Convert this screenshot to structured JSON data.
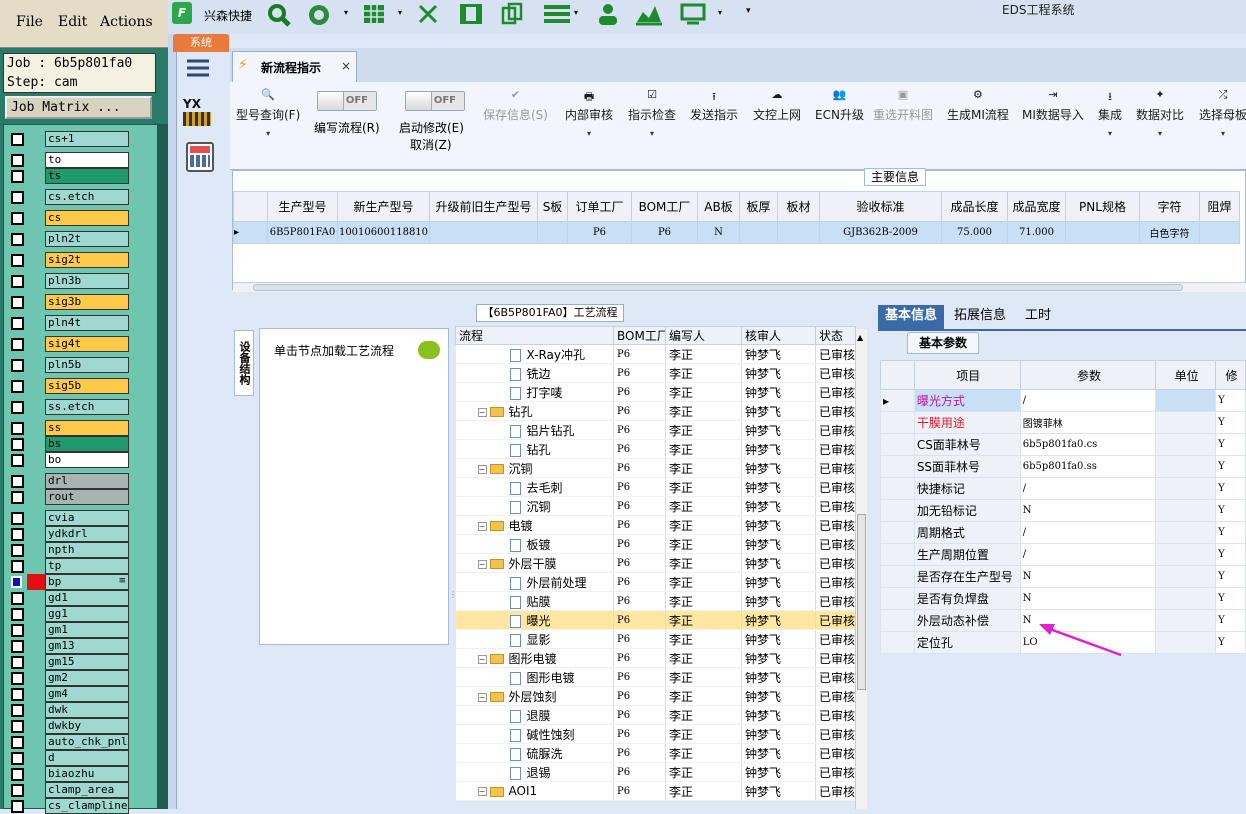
{
  "genesis": {
    "menu": [
      "File",
      "Edit",
      "Actions"
    ],
    "job_label": "Job : 6b5p801fa0",
    "step_label": "Step: cam",
    "job_matrix_button": "Job Matrix ...",
    "layers": [
      {
        "name": "cs+1",
        "color": "#9ed8d0"
      },
      {
        "name": "to",
        "color": "#ffffff"
      },
      {
        "name": "ts",
        "color": "#1f9a6e"
      },
      {
        "name": "cs.etch",
        "color": "#9ed8d0"
      },
      {
        "name": "cs",
        "color": "#ffc94a"
      },
      {
        "name": "pln2t",
        "color": "#9ed8d0"
      },
      {
        "name": "sig2t",
        "color": "#ffc94a"
      },
      {
        "name": "pln3b",
        "color": "#9ed8d0"
      },
      {
        "name": "sig3b",
        "color": "#ffc94a"
      },
      {
        "name": "pln4t",
        "color": "#9ed8d0"
      },
      {
        "name": "sig4t",
        "color": "#ffc94a"
      },
      {
        "name": "pln5b",
        "color": "#9ed8d0"
      },
      {
        "name": "sig5b",
        "color": "#ffc94a"
      },
      {
        "name": "ss.etch",
        "color": "#9ed8d0"
      },
      {
        "name": "ss",
        "color": "#ffc94a"
      },
      {
        "name": "bs",
        "color": "#1f9a6e"
      },
      {
        "name": "bo",
        "color": "#ffffff"
      },
      {
        "name": "drl",
        "color": "#a8b4b2"
      },
      {
        "name": "rout",
        "color": "#a8b4b2"
      },
      {
        "name": "cvia",
        "color": "#9ed8d0"
      },
      {
        "name": "ydkdrl",
        "color": "#9ed8d0"
      },
      {
        "name": "npth",
        "color": "#9ed8d0"
      },
      {
        "name": "tp",
        "color": "#9ed8d0"
      },
      {
        "name": "bp",
        "color": "#9ed8d0",
        "selected": true
      },
      {
        "name": "gd1",
        "color": "#9ed8d0"
      },
      {
        "name": "gg1",
        "color": "#9ed8d0"
      },
      {
        "name": "gm1",
        "color": "#9ed8d0"
      },
      {
        "name": "gm13",
        "color": "#9ed8d0"
      },
      {
        "name": "gm15",
        "color": "#9ed8d0"
      },
      {
        "name": "gm2",
        "color": "#9ed8d0"
      },
      {
        "name": "gm4",
        "color": "#9ed8d0"
      },
      {
        "name": "dwk",
        "color": "#9ed8d0"
      },
      {
        "name": "dwkby",
        "color": "#9ed8d0"
      },
      {
        "name": "auto_chk_pnl",
        "color": "#9ed8d0"
      },
      {
        "name": "d",
        "color": "#9ed8d0"
      },
      {
        "name": "biaozhu",
        "color": "#9ed8d0"
      },
      {
        "name": "clamp_area",
        "color": "#9ed8d0"
      },
      {
        "name": "cs_clampline",
        "color": "#9ed8d0"
      }
    ],
    "selected_marker": "≡"
  },
  "app": {
    "title": "EDS工程系统",
    "toolbar_label": "兴森快捷",
    "system_tab": "系统",
    "doc_tab": "新流程指示",
    "doc_tab_close": "×"
  },
  "ribbon": {
    "buttons": [
      {
        "label": "型号查询(F)",
        "icon": "magnifier",
        "glyph": "🔍",
        "has_arrow": true,
        "disabled": false
      },
      {
        "label": "保存信息(S)",
        "icon": "check",
        "glyph": "✔",
        "has_arrow": false,
        "disabled": true
      },
      {
        "label": "内部审核",
        "icon": "printer",
        "glyph": "🖶",
        "has_arrow": true,
        "disabled": false
      },
      {
        "label": "指示检查",
        "icon": "checkbox",
        "glyph": "☑",
        "has_arrow": true,
        "disabled": false
      },
      {
        "label": "发送指示",
        "icon": "upload",
        "glyph": "⭱",
        "has_arrow": false,
        "disabled": false
      },
      {
        "label": "文控上网",
        "icon": "cloud",
        "glyph": "☁",
        "has_arrow": false,
        "disabled": false
      },
      {
        "label": "ECN升级",
        "icon": "people",
        "glyph": "👥",
        "has_arrow": false,
        "disabled": false
      },
      {
        "label": "重选开料图",
        "icon": "image",
        "glyph": "▣",
        "has_arrow": false,
        "disabled": true
      },
      {
        "label": "生成MI流程",
        "icon": "gears",
        "glyph": "⚙",
        "has_arrow": false,
        "disabled": false
      },
      {
        "label": "MI数据导入",
        "icon": "import",
        "glyph": "⇥",
        "has_arrow": false,
        "disabled": false
      },
      {
        "label": "集成",
        "icon": "download",
        "glyph": "⭳",
        "has_arrow": true,
        "disabled": false
      },
      {
        "label": "数据对比",
        "icon": "wand",
        "glyph": "✦",
        "has_arrow": true,
        "disabled": false
      },
      {
        "label": "选择母板",
        "icon": "shuffle",
        "glyph": "⤮",
        "has_arrow": true,
        "disabled": false
      }
    ],
    "toggle1": {
      "state": "OFF",
      "label": "编写流程(R)"
    },
    "toggle2": {
      "state": "OFF",
      "label": "启动修改(E)",
      "sublabel": "取消(Z)"
    }
  },
  "main_info": {
    "legend": "主要信息",
    "columns": [
      "生产型号",
      "新生产型号",
      "升级前旧生产型号",
      "S板",
      "订单工厂",
      "BOM工厂",
      "AB板",
      "板厚",
      "板材",
      "验收标准",
      "成品长度",
      "成品宽度",
      "PNL规格",
      "字符",
      "阻焊"
    ],
    "row": [
      "6B5P801FA0",
      "10010600118810",
      "",
      "",
      "P6",
      "P6",
      "N",
      "",
      "",
      "GJB362B-2009",
      "75.000",
      "71.000",
      "",
      "白色字符",
      ""
    ],
    "row_indicator": "▸"
  },
  "process": {
    "title": "【6B5P801FA0】工艺流程",
    "vertical_tab": "设备结构",
    "node_hint": "单击节点加载工艺流程",
    "columns": [
      "流程",
      "BOM工厂",
      "编写人",
      "核审人",
      "状态"
    ],
    "rows": [
      {
        "name": "X-Ray冲孔",
        "level": 2,
        "factory": "P6",
        "writer": "李正",
        "reviewer": "钟梦飞",
        "status": "已审核"
      },
      {
        "name": "铣边",
        "level": 2,
        "factory": "P6",
        "writer": "李正",
        "reviewer": "钟梦飞",
        "status": "已审核"
      },
      {
        "name": "打字唛",
        "level": 2,
        "factory": "P6",
        "writer": "李正",
        "reviewer": "钟梦飞",
        "status": "已审核"
      },
      {
        "name": "钻孔",
        "level": 1,
        "factory": "P6",
        "writer": "李正",
        "reviewer": "钟梦飞",
        "status": "已审核"
      },
      {
        "name": "铝片钻孔",
        "level": 2,
        "factory": "P6",
        "writer": "李正",
        "reviewer": "钟梦飞",
        "status": "已审核"
      },
      {
        "name": "钻孔",
        "level": 2,
        "factory": "P6",
        "writer": "李正",
        "reviewer": "钟梦飞",
        "status": "已审核"
      },
      {
        "name": "沉铜",
        "level": 1,
        "factory": "P6",
        "writer": "李正",
        "reviewer": "钟梦飞",
        "status": "已审核"
      },
      {
        "name": "去毛刺",
        "level": 2,
        "factory": "P6",
        "writer": "李正",
        "reviewer": "钟梦飞",
        "status": "已审核"
      },
      {
        "name": "沉铜",
        "level": 2,
        "factory": "P6",
        "writer": "李正",
        "reviewer": "钟梦飞",
        "status": "已审核"
      },
      {
        "name": "电镀",
        "level": 1,
        "factory": "P6",
        "writer": "李正",
        "reviewer": "钟梦飞",
        "status": "已审核"
      },
      {
        "name": "板镀",
        "level": 2,
        "factory": "P6",
        "writer": "李正",
        "reviewer": "钟梦飞",
        "status": "已审核"
      },
      {
        "name": "外层干膜",
        "level": 1,
        "factory": "P6",
        "writer": "李正",
        "reviewer": "钟梦飞",
        "status": "已审核"
      },
      {
        "name": "外层前处理",
        "level": 2,
        "factory": "P6",
        "writer": "李正",
        "reviewer": "钟梦飞",
        "status": "已审核"
      },
      {
        "name": "贴膜",
        "level": 2,
        "factory": "P6",
        "writer": "李正",
        "reviewer": "钟梦飞",
        "status": "已审核"
      },
      {
        "name": "曝光",
        "level": 2,
        "factory": "P6",
        "writer": "李正",
        "reviewer": "钟梦飞",
        "status": "已审核",
        "selected": true
      },
      {
        "name": "显影",
        "level": 2,
        "factory": "P6",
        "writer": "李正",
        "reviewer": "钟梦飞",
        "status": "已审核"
      },
      {
        "name": "图形电镀",
        "level": 1,
        "factory": "P6",
        "writer": "李正",
        "reviewer": "钟梦飞",
        "status": "已审核"
      },
      {
        "name": "图形电镀",
        "level": 2,
        "factory": "P6",
        "writer": "李正",
        "reviewer": "钟梦飞",
        "status": "已审核"
      },
      {
        "name": "外层蚀刻",
        "level": 1,
        "factory": "P6",
        "writer": "李正",
        "reviewer": "钟梦飞",
        "status": "已审核"
      },
      {
        "name": "退膜",
        "level": 2,
        "factory": "P6",
        "writer": "李正",
        "reviewer": "钟梦飞",
        "status": "已审核"
      },
      {
        "name": "碱性蚀刻",
        "level": 2,
        "factory": "P6",
        "writer": "李正",
        "reviewer": "钟梦飞",
        "status": "已审核"
      },
      {
        "name": "硫脲洗",
        "level": 2,
        "factory": "P6",
        "writer": "李正",
        "reviewer": "钟梦飞",
        "status": "已审核"
      },
      {
        "name": "退锡",
        "level": 2,
        "factory": "P6",
        "writer": "李正",
        "reviewer": "钟梦飞",
        "status": "已审核"
      },
      {
        "name": "AOI1",
        "level": 1,
        "factory": "P6",
        "writer": "李正",
        "reviewer": "钟梦飞",
        "status": "已审核"
      }
    ]
  },
  "right_panel": {
    "tabs": [
      "基本信息",
      "拓展信息",
      "工时"
    ],
    "subtab": "基本参数",
    "columns": [
      "项目",
      "参数",
      "单位",
      "修"
    ],
    "rows": [
      {
        "item": "曝光方式",
        "value": "/",
        "unit": "",
        "flag": "Y",
        "color": "#c0169a",
        "selected": true
      },
      {
        "item": "干膜用途",
        "value": "图镀菲林",
        "unit": "",
        "flag": "Y",
        "color": "#e01a2a"
      },
      {
        "item": "CS面菲林号",
        "value": "6b5p801fa0.cs",
        "unit": "",
        "flag": "Y",
        "color": "#000000"
      },
      {
        "item": "SS面菲林号",
        "value": "6b5p801fa0.ss",
        "unit": "",
        "flag": "Y",
        "color": "#000000"
      },
      {
        "item": "快捷标记",
        "value": "/",
        "unit": "",
        "flag": "Y",
        "color": "#000000"
      },
      {
        "item": "加无铅标记",
        "value": "N",
        "unit": "",
        "flag": "Y",
        "color": "#000000"
      },
      {
        "item": "周期格式",
        "value": "/",
        "unit": "",
        "flag": "Y",
        "color": "#000000"
      },
      {
        "item": "生产周期位置",
        "value": "/",
        "unit": "",
        "flag": "Y",
        "color": "#000000"
      },
      {
        "item": "是否存在生产型号",
        "value": "N",
        "unit": "",
        "flag": "Y",
        "color": "#000000"
      },
      {
        "item": "是否有负焊盘",
        "value": "N",
        "unit": "",
        "flag": "Y",
        "color": "#000000"
      },
      {
        "item": "外层动态补偿",
        "value": "N",
        "unit": "",
        "flag": "Y",
        "color": "#000000"
      },
      {
        "item": "定位孔",
        "value": "LO",
        "unit": "",
        "flag": "Y",
        "color": "#000000"
      }
    ]
  },
  "colors": {
    "accent": "#e87a3c",
    "annotation_arrow": "#e020d0",
    "selection": "#ffe7a2"
  }
}
